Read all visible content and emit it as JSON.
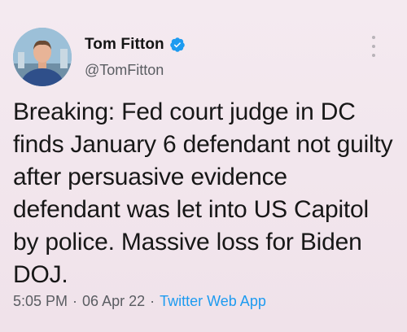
{
  "tweet": {
    "author": {
      "display_name": "Tom Fitton",
      "handle": "@TomFitton",
      "verified": true
    },
    "text": "Breaking: Fed court judge in DC finds January 6 defendant not guilty after persuasive evidence defendant was let into US Capitol by police. Massive loss for Biden DOJ.",
    "meta": {
      "time": "5:05 PM",
      "separator": "·",
      "date": "06 Apr 22",
      "source": "Twitter Web App"
    }
  },
  "colors": {
    "background": "#f2e6ed",
    "verified_badge": "#1d9bf0",
    "source_link": "#1d9bf0",
    "secondary_text": "#5a5d62"
  },
  "icons": {
    "verified": "verified-badge-icon",
    "more": "more-vertical-icon"
  }
}
